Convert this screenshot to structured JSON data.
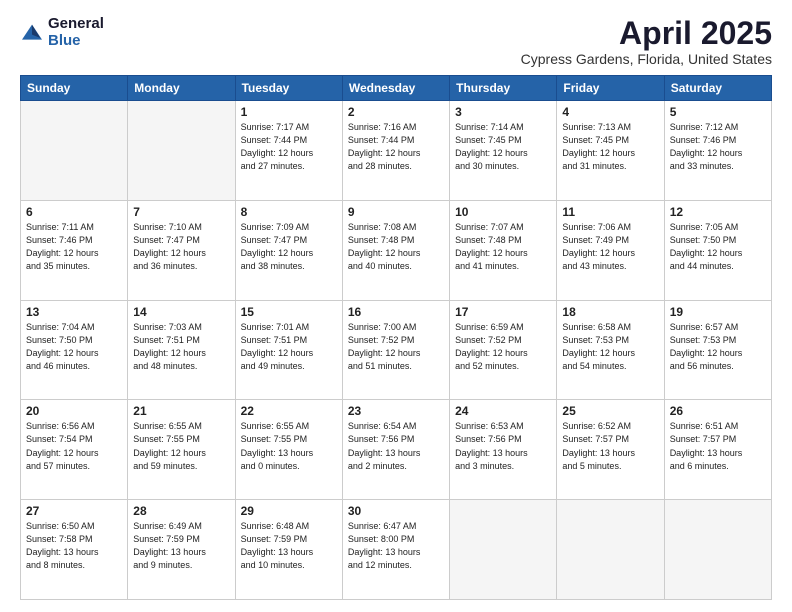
{
  "logo": {
    "general": "General",
    "blue": "Blue"
  },
  "title": "April 2025",
  "location": "Cypress Gardens, Florida, United States",
  "days_header": [
    "Sunday",
    "Monday",
    "Tuesday",
    "Wednesday",
    "Thursday",
    "Friday",
    "Saturday"
  ],
  "weeks": [
    [
      {
        "num": "",
        "info": ""
      },
      {
        "num": "",
        "info": ""
      },
      {
        "num": "1",
        "info": "Sunrise: 7:17 AM\nSunset: 7:44 PM\nDaylight: 12 hours\nand 27 minutes."
      },
      {
        "num": "2",
        "info": "Sunrise: 7:16 AM\nSunset: 7:44 PM\nDaylight: 12 hours\nand 28 minutes."
      },
      {
        "num": "3",
        "info": "Sunrise: 7:14 AM\nSunset: 7:45 PM\nDaylight: 12 hours\nand 30 minutes."
      },
      {
        "num": "4",
        "info": "Sunrise: 7:13 AM\nSunset: 7:45 PM\nDaylight: 12 hours\nand 31 minutes."
      },
      {
        "num": "5",
        "info": "Sunrise: 7:12 AM\nSunset: 7:46 PM\nDaylight: 12 hours\nand 33 minutes."
      }
    ],
    [
      {
        "num": "6",
        "info": "Sunrise: 7:11 AM\nSunset: 7:46 PM\nDaylight: 12 hours\nand 35 minutes."
      },
      {
        "num": "7",
        "info": "Sunrise: 7:10 AM\nSunset: 7:47 PM\nDaylight: 12 hours\nand 36 minutes."
      },
      {
        "num": "8",
        "info": "Sunrise: 7:09 AM\nSunset: 7:47 PM\nDaylight: 12 hours\nand 38 minutes."
      },
      {
        "num": "9",
        "info": "Sunrise: 7:08 AM\nSunset: 7:48 PM\nDaylight: 12 hours\nand 40 minutes."
      },
      {
        "num": "10",
        "info": "Sunrise: 7:07 AM\nSunset: 7:48 PM\nDaylight: 12 hours\nand 41 minutes."
      },
      {
        "num": "11",
        "info": "Sunrise: 7:06 AM\nSunset: 7:49 PM\nDaylight: 12 hours\nand 43 minutes."
      },
      {
        "num": "12",
        "info": "Sunrise: 7:05 AM\nSunset: 7:50 PM\nDaylight: 12 hours\nand 44 minutes."
      }
    ],
    [
      {
        "num": "13",
        "info": "Sunrise: 7:04 AM\nSunset: 7:50 PM\nDaylight: 12 hours\nand 46 minutes."
      },
      {
        "num": "14",
        "info": "Sunrise: 7:03 AM\nSunset: 7:51 PM\nDaylight: 12 hours\nand 48 minutes."
      },
      {
        "num": "15",
        "info": "Sunrise: 7:01 AM\nSunset: 7:51 PM\nDaylight: 12 hours\nand 49 minutes."
      },
      {
        "num": "16",
        "info": "Sunrise: 7:00 AM\nSunset: 7:52 PM\nDaylight: 12 hours\nand 51 minutes."
      },
      {
        "num": "17",
        "info": "Sunrise: 6:59 AM\nSunset: 7:52 PM\nDaylight: 12 hours\nand 52 minutes."
      },
      {
        "num": "18",
        "info": "Sunrise: 6:58 AM\nSunset: 7:53 PM\nDaylight: 12 hours\nand 54 minutes."
      },
      {
        "num": "19",
        "info": "Sunrise: 6:57 AM\nSunset: 7:53 PM\nDaylight: 12 hours\nand 56 minutes."
      }
    ],
    [
      {
        "num": "20",
        "info": "Sunrise: 6:56 AM\nSunset: 7:54 PM\nDaylight: 12 hours\nand 57 minutes."
      },
      {
        "num": "21",
        "info": "Sunrise: 6:55 AM\nSunset: 7:55 PM\nDaylight: 12 hours\nand 59 minutes."
      },
      {
        "num": "22",
        "info": "Sunrise: 6:55 AM\nSunset: 7:55 PM\nDaylight: 13 hours\nand 0 minutes."
      },
      {
        "num": "23",
        "info": "Sunrise: 6:54 AM\nSunset: 7:56 PM\nDaylight: 13 hours\nand 2 minutes."
      },
      {
        "num": "24",
        "info": "Sunrise: 6:53 AM\nSunset: 7:56 PM\nDaylight: 13 hours\nand 3 minutes."
      },
      {
        "num": "25",
        "info": "Sunrise: 6:52 AM\nSunset: 7:57 PM\nDaylight: 13 hours\nand 5 minutes."
      },
      {
        "num": "26",
        "info": "Sunrise: 6:51 AM\nSunset: 7:57 PM\nDaylight: 13 hours\nand 6 minutes."
      }
    ],
    [
      {
        "num": "27",
        "info": "Sunrise: 6:50 AM\nSunset: 7:58 PM\nDaylight: 13 hours\nand 8 minutes."
      },
      {
        "num": "28",
        "info": "Sunrise: 6:49 AM\nSunset: 7:59 PM\nDaylight: 13 hours\nand 9 minutes."
      },
      {
        "num": "29",
        "info": "Sunrise: 6:48 AM\nSunset: 7:59 PM\nDaylight: 13 hours\nand 10 minutes."
      },
      {
        "num": "30",
        "info": "Sunrise: 6:47 AM\nSunset: 8:00 PM\nDaylight: 13 hours\nand 12 minutes."
      },
      {
        "num": "",
        "info": ""
      },
      {
        "num": "",
        "info": ""
      },
      {
        "num": "",
        "info": ""
      }
    ]
  ]
}
